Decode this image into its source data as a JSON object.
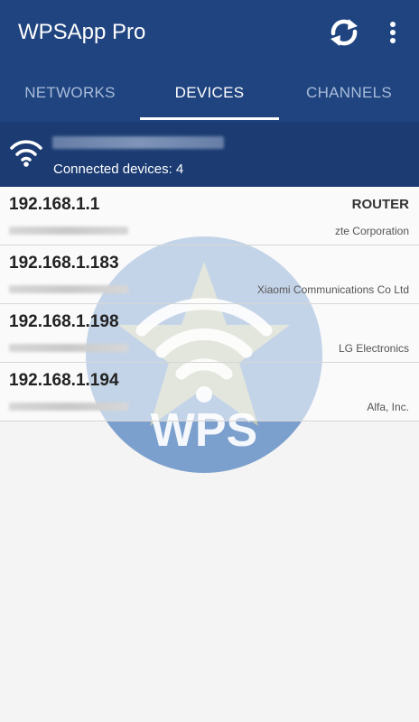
{
  "app": {
    "title": "WPSApp Pro",
    "colors": {
      "primary": "#1f4480",
      "primary_dark": "#1b3b72",
      "background": "#f4f4f4"
    }
  },
  "toolbar": {
    "refresh_icon": "refresh-icon",
    "menu_icon": "more-vert-icon"
  },
  "tabs": [
    {
      "label": "NETWORKS",
      "active": false
    },
    {
      "label": "DEVICES",
      "active": true
    },
    {
      "label": "CHANNELS",
      "active": false
    }
  ],
  "network": {
    "icon": "wifi-icon",
    "connected_label": "Connected devices: 4"
  },
  "devices": [
    {
      "ip": "192.168.1.1",
      "role": "ROUTER",
      "vendor": "zte Corporation"
    },
    {
      "ip": "192.168.1.183",
      "role": "",
      "vendor": "Xiaomi Communications Co Ltd"
    },
    {
      "ip": "192.168.1.198",
      "role": "",
      "vendor": "LG Electronics"
    },
    {
      "ip": "192.168.1.194",
      "role": "",
      "vendor": "Alfa, Inc."
    }
  ],
  "watermark": {
    "text": "WPS"
  }
}
